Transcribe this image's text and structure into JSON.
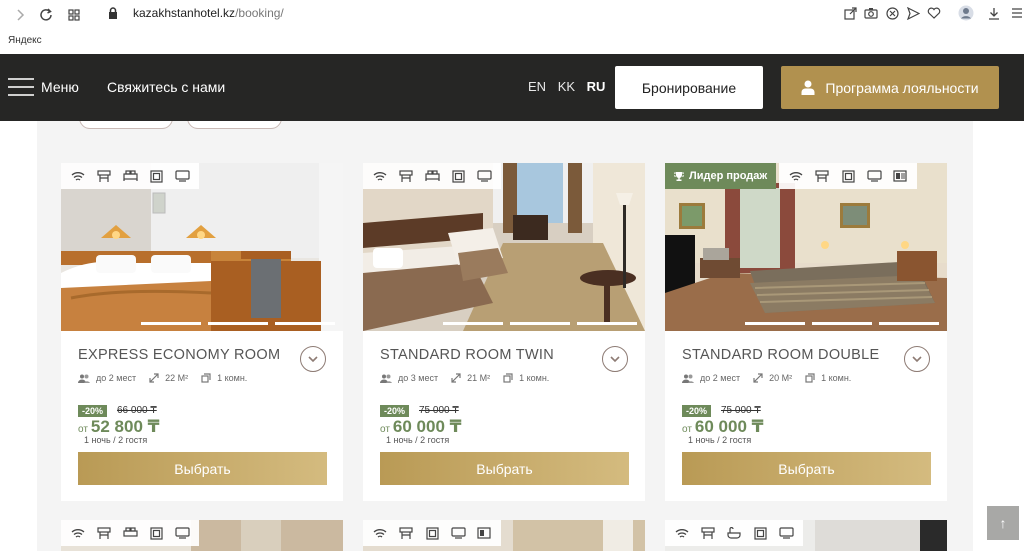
{
  "browser": {
    "domain": "kazakhstanhotel.kz",
    "path": "/booking/",
    "bookmark": "Яндекс"
  },
  "header": {
    "menu_label": "Меню",
    "contact_label": "Свяжитесь с нами",
    "languages": [
      "EN",
      "KK",
      "RU"
    ],
    "active_language": "RU",
    "booking_button": "Бронирование",
    "loyalty_button": "Программа лояльности"
  },
  "rooms": [
    {
      "title": "EXPRESS ECONOMY ROOM",
      "guests": "до 2 мест",
      "area": "22 М²",
      "rooms": "1 комн.",
      "discount": "-20%",
      "old_price": "66 000 ₸",
      "price_prefix": "от",
      "price": "52 800 ₸",
      "stay": "1 ночь / 2 гостя",
      "select_label": "Выбрать",
      "badge": ""
    },
    {
      "title": "STANDARD ROOM TWIN",
      "guests": "до 3 мест",
      "area": "21 М²",
      "rooms": "1 комн.",
      "discount": "-20%",
      "old_price": "75 000 ₸",
      "price_prefix": "от",
      "price": "60 000 ₸",
      "stay": "1 ночь / 2 гостя",
      "select_label": "Выбрать",
      "badge": ""
    },
    {
      "title": "STANDARD ROOM DOUBLE",
      "guests": "до 2 мест",
      "area": "20 М²",
      "rooms": "1 комн.",
      "discount": "-20%",
      "old_price": "75 000 ₸",
      "price_prefix": "от",
      "price": "60 000 ₸",
      "stay": "1 ночь / 2 гостя",
      "select_label": "Выбрать",
      "badge": "Лидер продаж"
    }
  ],
  "scroll_top_icon": "↑",
  "colors": {
    "header_bg": "#262625",
    "gold": "#b1914f",
    "green": "#6e8a5a"
  }
}
